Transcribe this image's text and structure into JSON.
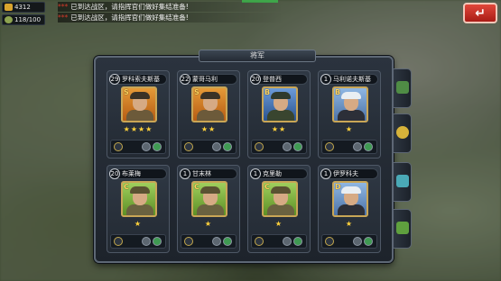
{
  "resources": {
    "gold": "4312",
    "supply": "118/100"
  },
  "chat": [
    {
      "sender": "***",
      "message": "已到达战区，请指挥官们做好集结准备!"
    },
    {
      "sender": "***",
      "message": "已到达战区，请指挥官们做好集结准备!"
    }
  ],
  "exit_button": {
    "label": "↵"
  },
  "panel": {
    "title": "将军"
  },
  "generals": [
    {
      "level": "29",
      "name": "罗科索夫斯基",
      "rank": "S",
      "stars": "★★★★",
      "color": "orange"
    },
    {
      "level": "22",
      "name": "蒙哥马利",
      "rank": "S",
      "stars": "★★",
      "color": "orange"
    },
    {
      "level": "20",
      "name": "登普西",
      "rank": "B",
      "stars": "★★",
      "color": "blue"
    },
    {
      "level": "1",
      "name": "马利诺夫斯基",
      "rank": "B",
      "stars": "★",
      "color": "lblue"
    },
    {
      "level": "20",
      "name": "布莱梅",
      "rank": "C",
      "stars": "★",
      "color": "green"
    },
    {
      "level": "1",
      "name": "甘末林",
      "rank": "C",
      "stars": "★",
      "color": "green"
    },
    {
      "level": "1",
      "name": "克里勒",
      "rank": "C",
      "stars": "★",
      "color": "green"
    },
    {
      "level": "1",
      "name": "伊罗科夫",
      "rank": "D",
      "stars": "★",
      "color": "lblue"
    }
  ],
  "side_tabs": [
    "unit-icon",
    "medal-icon",
    "chest-icon",
    "supply-icon"
  ]
}
